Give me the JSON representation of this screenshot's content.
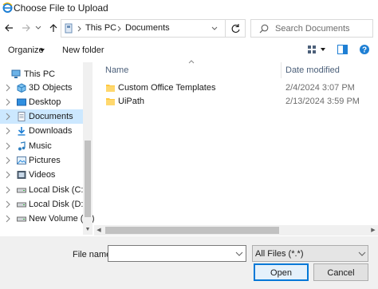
{
  "window": {
    "title": "Choose File to Upload"
  },
  "address": {
    "crumbs": [
      "This PC",
      "Documents"
    ],
    "search_placeholder": "Search Documents",
    "icons": {
      "back": "arrow-left-icon",
      "forward": "arrow-right-icon",
      "recent": "chevron-down-icon",
      "up": "arrow-up-icon",
      "refresh": "refresh-icon",
      "search": "search-icon"
    }
  },
  "toolbar": {
    "organize_label": "Organize",
    "new_folder_label": "New folder"
  },
  "sidebar": {
    "items": [
      {
        "label": "This PC",
        "icon": "computer-icon"
      },
      {
        "label": "3D Objects",
        "icon": "3d-objects-icon"
      },
      {
        "label": "Desktop",
        "icon": "desktop-icon"
      },
      {
        "label": "Documents",
        "icon": "documents-icon",
        "selected": true
      },
      {
        "label": "Downloads",
        "icon": "downloads-icon"
      },
      {
        "label": "Music",
        "icon": "music-icon"
      },
      {
        "label": "Pictures",
        "icon": "pictures-icon"
      },
      {
        "label": "Videos",
        "icon": "videos-icon"
      },
      {
        "label": "Local Disk (C:)",
        "icon": "drive-icon"
      },
      {
        "label": "Local Disk (D:)",
        "icon": "drive-icon"
      },
      {
        "label": "New Volume (E:)",
        "icon": "drive-icon"
      }
    ]
  },
  "list": {
    "columns": {
      "name": "Name",
      "date": "Date modified"
    },
    "rows": [
      {
        "name": "Custom Office Templates",
        "date": "2/4/2024 3:07 PM",
        "icon": "folder-icon"
      },
      {
        "name": "UiPath",
        "date": "2/13/2024 3:59 PM",
        "icon": "folder-icon"
      }
    ]
  },
  "footer": {
    "file_name_label": "File name:",
    "file_name_value": "",
    "file_type": "All Files (*.*)",
    "open_label": "Open",
    "cancel_label": "Cancel"
  },
  "colors": {
    "accent": "#0078d7",
    "selection": "#cce8ff",
    "folder": "#ffc83d"
  }
}
